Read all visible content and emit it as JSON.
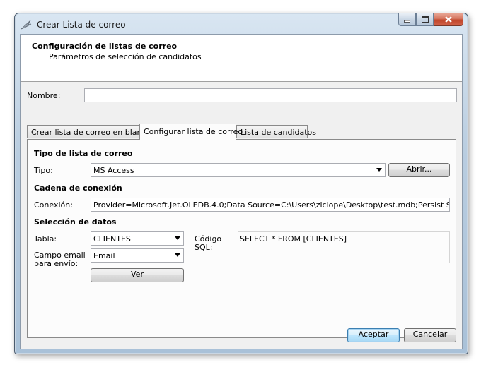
{
  "window": {
    "title": "Crear Lista de correo",
    "icon": "feather-icon"
  },
  "header": {
    "title": "Configuración de listas de correo",
    "subtitle": "Parámetros de selección de candidatos"
  },
  "nombre": {
    "label": "Nombre:",
    "value": ""
  },
  "tabs": [
    {
      "label": "Crear lista de correo en blanco",
      "active": false
    },
    {
      "label": "Configurar lista de correo",
      "active": true
    },
    {
      "label": "Lista de candidatos",
      "active": false
    }
  ],
  "tipo_section": {
    "heading": "Tipo de lista de correo",
    "label": "Tipo:",
    "selected": "MS Access",
    "open_button": "Abrir..."
  },
  "conexion_section": {
    "heading": "Cadena de conexión",
    "label": "Conexión:",
    "value": "Provider=Microsoft.Jet.OLEDB.4.0;Data Source=C:\\Users\\ziclope\\Desktop\\test.mdb;Persist Security"
  },
  "datos_section": {
    "heading": "Selección de datos",
    "tabla_label": "Tabla:",
    "tabla_value": "CLIENTES",
    "campo_label_1": "Campo email",
    "campo_label_2": "para envío:",
    "campo_value": "Email",
    "ver_button": "Ver",
    "sql_label_1": "Código",
    "sql_label_2": "SQL:",
    "sql_value": "SELECT * FROM [CLIENTES]"
  },
  "footer": {
    "accept_button": "Aceptar",
    "cancel_button": "Cancelar"
  }
}
